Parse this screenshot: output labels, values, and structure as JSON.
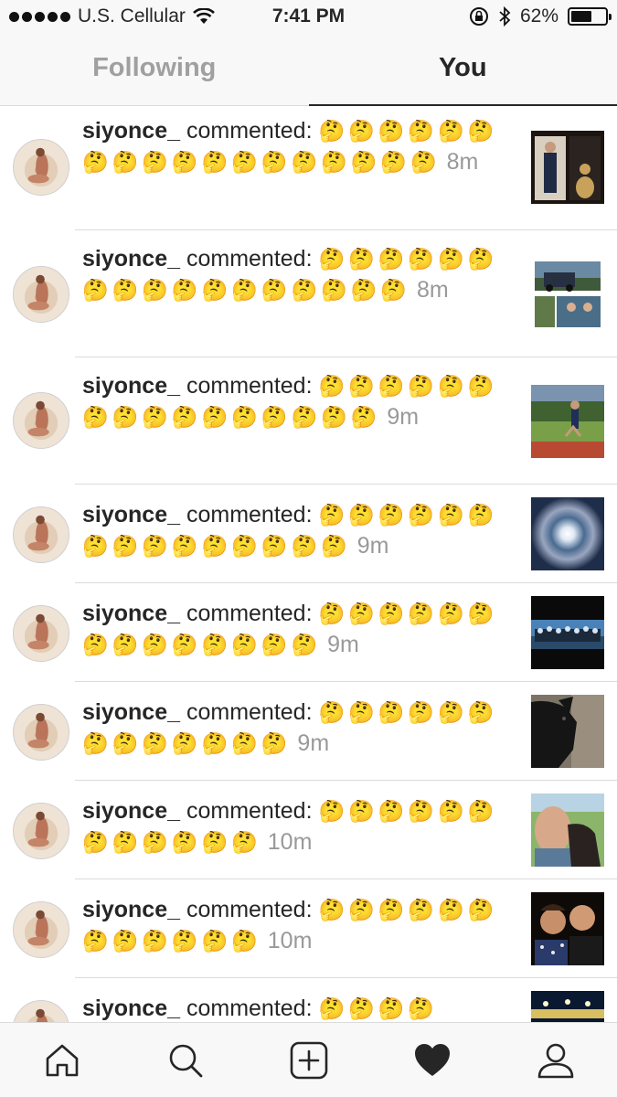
{
  "status": {
    "carrier": "U.S. Cellular",
    "time": "7:41 PM",
    "battery": "62%",
    "battery_level": 0.62
  },
  "tabs": [
    {
      "label": "Following",
      "active": false
    },
    {
      "label": "You",
      "active": true
    }
  ],
  "activity": [
    {
      "user": "siyonce_",
      "action": "commented:",
      "emojis": "🤔🤔🤔🤔🤔🤔🤔🤔🤔🤔🤔🤔🤔🤔🤔🤔🤔🤔",
      "time": "8m",
      "thumb": "trophy-photo"
    },
    {
      "user": "siyonce_",
      "action": "commented:",
      "emojis": "🤔🤔🤔🤔🤔🤔🤔🤔🤔🤔🤔🤔🤔🤔🤔🤔🤔",
      "time": "8m",
      "thumb": "truck-collage-photo"
    },
    {
      "user": "siyonce_",
      "action": "commented:",
      "emojis": "🤔🤔🤔🤔🤔🤔🤔🤔🤔🤔🤔🤔🤔🤔🤔🤔",
      "time": "9m",
      "thumb": "track-field-photo"
    },
    {
      "user": "siyonce_",
      "action": "commented:",
      "emojis": "🤔🤔🤔🤔🤔🤔🤔🤔🤔🤔🤔🤔🤔🤔🤔",
      "time": "9m",
      "thumb": "sun-halo-photo"
    },
    {
      "user": "siyonce_",
      "action": "commented:",
      "emojis": "🤔🤔🤔🤔🤔🤔🤔🤔🤔🤔🤔🤔🤔🤔",
      "time": "9m",
      "thumb": "team-photo"
    },
    {
      "user": "siyonce_",
      "action": "commented:",
      "emojis": "🤔🤔🤔🤔🤔🤔🤔🤔🤔🤔🤔🤔🤔",
      "time": "9m",
      "thumb": "dog-photo"
    },
    {
      "user": "siyonce_",
      "action": "commented:",
      "emojis": "🤔🤔🤔🤔🤔🤔🤔🤔🤔🤔🤔🤔",
      "time": "10m",
      "thumb": "selfie-dog-photo"
    },
    {
      "user": "siyonce_",
      "action": "commented:",
      "emojis": "🤔🤔🤔🤔🤔🤔🤔🤔🤔🤔🤔🤔",
      "time": "10m",
      "thumb": "friends-photo"
    },
    {
      "user": "siyonce_",
      "action": "commented:",
      "emojis": "🤔🤔🤔🤔",
      "time": "",
      "thumb": "stadium-photo"
    }
  ],
  "nav": [
    {
      "icon": "home-icon"
    },
    {
      "icon": "search-icon"
    },
    {
      "icon": "add-post-icon"
    },
    {
      "icon": "heart-icon",
      "active": true
    },
    {
      "icon": "profile-icon"
    }
  ]
}
